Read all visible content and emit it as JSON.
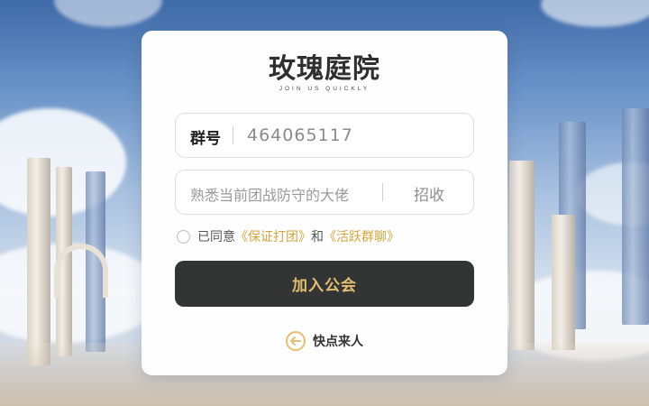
{
  "brand": {
    "title": "玫瑰庭院",
    "subtitle": "JOIN US QUICKLY"
  },
  "group_field": {
    "label": "群号",
    "value": "464065117"
  },
  "recruit_field": {
    "text": "熟悉当前团战防守的大佬",
    "label": "招收"
  },
  "agreement": {
    "prefix": "已同意",
    "link1": "《保证打团》",
    "conjunction": "和",
    "link2": "《活跃群聊》",
    "checked": false
  },
  "join_button": {
    "label": "加入公会"
  },
  "back_link": {
    "label": "快点来人",
    "icon": "arrow-left-icon"
  },
  "colors": {
    "accent_gold": "#e2bf70",
    "button_dark": "#333534",
    "card_bg": "#fefefe"
  }
}
